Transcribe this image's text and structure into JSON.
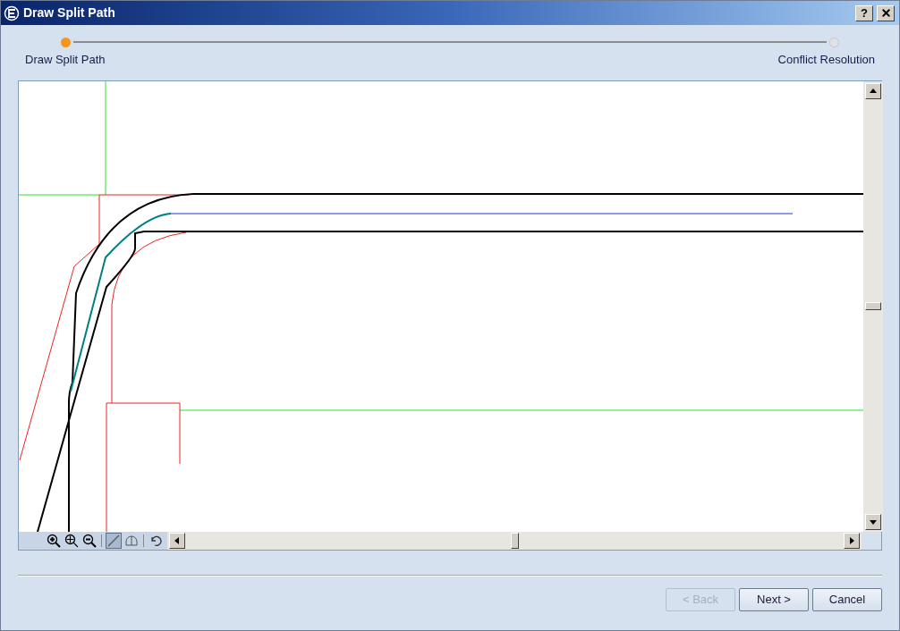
{
  "window": {
    "title": "Draw Split Path",
    "help_button": "?"
  },
  "steps": [
    {
      "label": "Draw Split Path",
      "selected": true
    },
    {
      "label": "Conflict Resolution",
      "selected": false
    }
  ],
  "tools": [
    {
      "kind": "zoom-in",
      "selected": false
    },
    {
      "kind": "zoom-extent",
      "selected": false
    },
    {
      "kind": "zoom-out",
      "selected": false
    },
    {
      "kind": "separator"
    },
    {
      "kind": "line",
      "selected": true
    },
    {
      "kind": "arc",
      "selected": false
    },
    {
      "kind": "separator"
    },
    {
      "kind": "undo",
      "selected": false
    }
  ],
  "buttons": [
    {
      "label": "< Back",
      "disabled": true
    },
    {
      "label": "Next >",
      "disabled": false
    },
    {
      "label": "Cancel",
      "disabled": false
    }
  ]
}
